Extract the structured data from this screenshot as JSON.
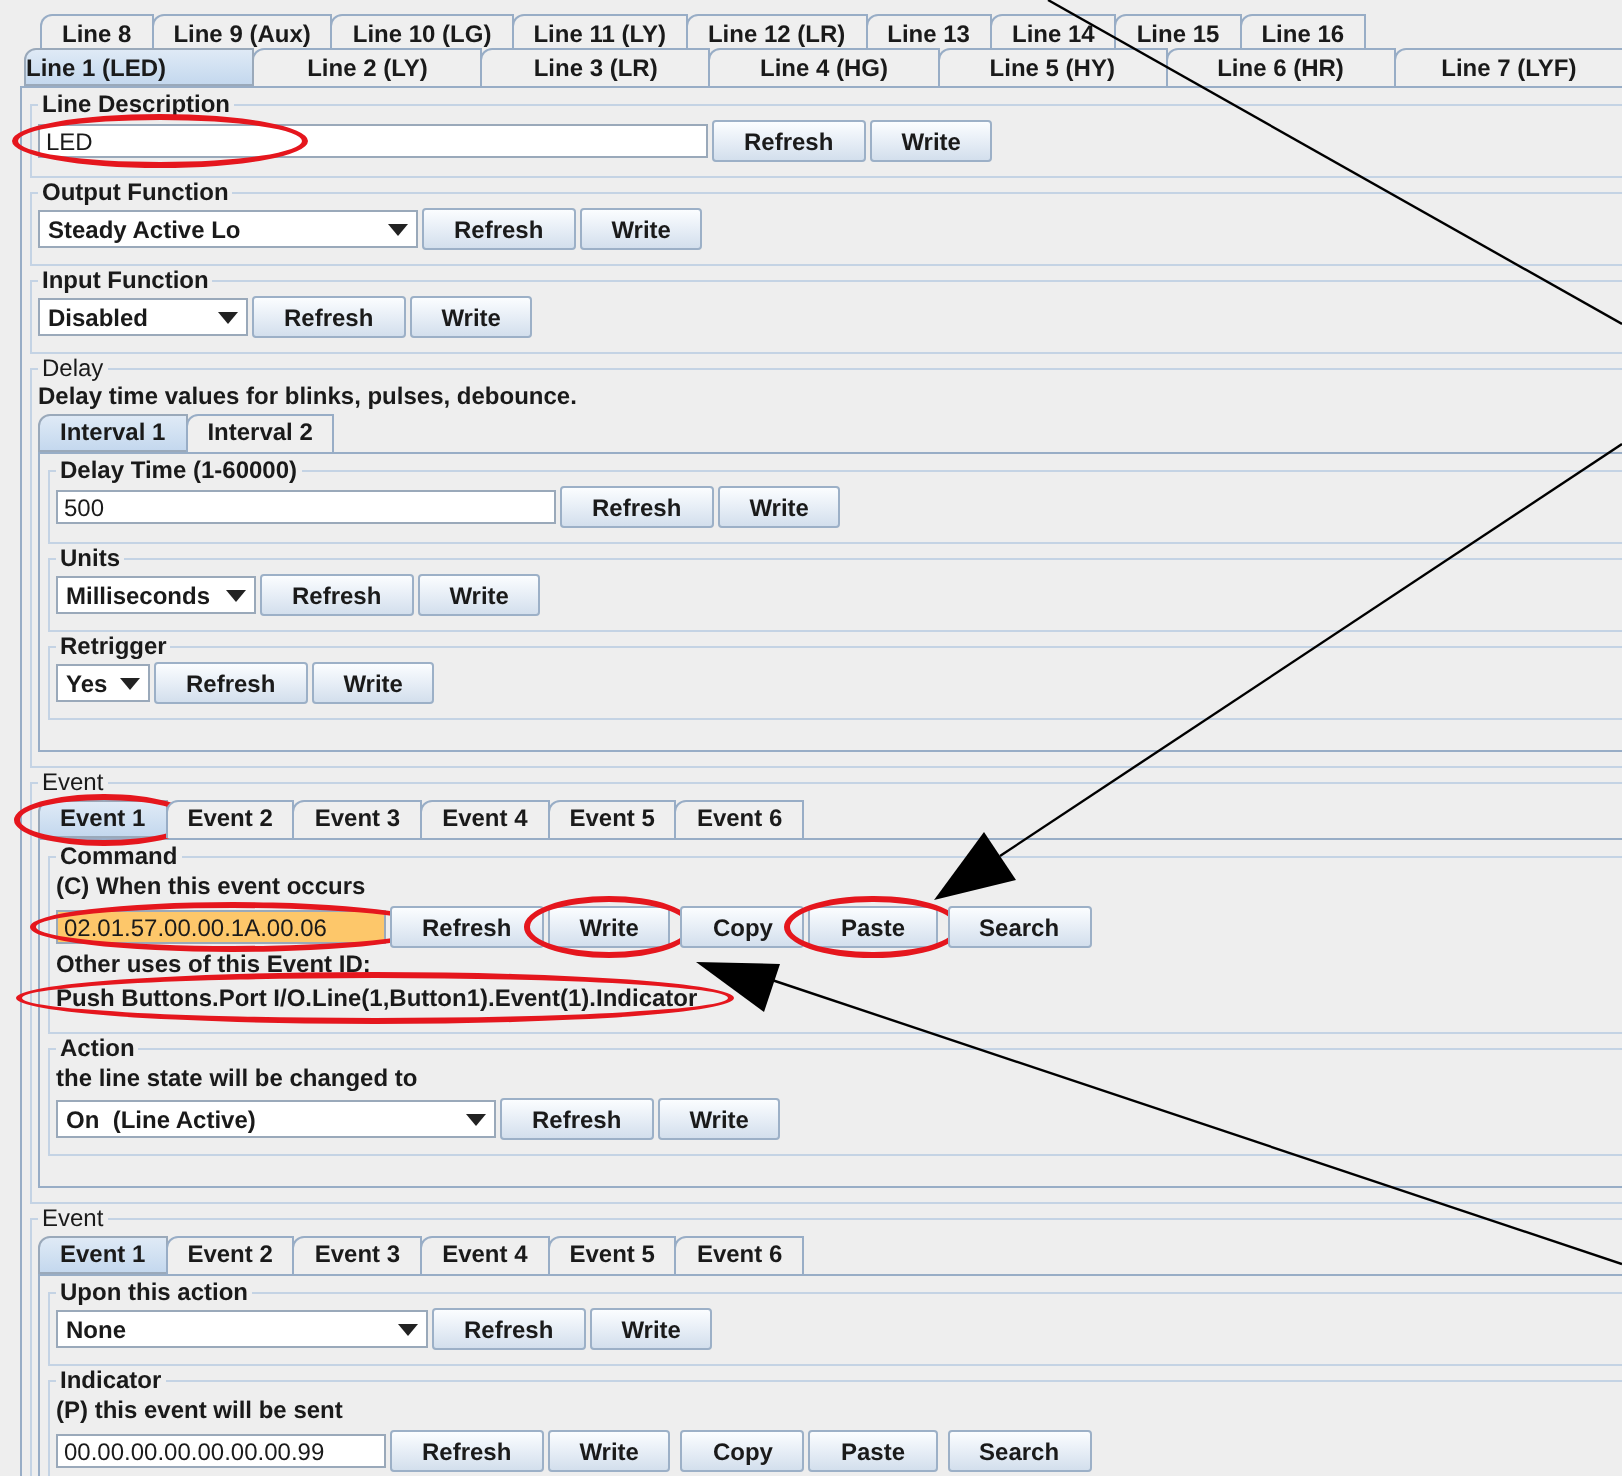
{
  "line_tabs_back_row": [
    {
      "label": "Line 8",
      "selected": false
    },
    {
      "label": "Line 9 (Aux)",
      "selected": false
    },
    {
      "label": "Line 10 (LG)",
      "selected": false
    },
    {
      "label": "Line 11 (LY)",
      "selected": false
    },
    {
      "label": "Line 12 (LR)",
      "selected": false
    },
    {
      "label": "Line 13",
      "selected": false
    },
    {
      "label": "Line 14",
      "selected": false
    },
    {
      "label": "Line 15",
      "selected": false
    },
    {
      "label": "Line 16",
      "selected": false
    }
  ],
  "line_tabs_front_row": [
    {
      "label": "Line 1 (LED)",
      "selected": true
    },
    {
      "label": "Line 2 (LY)",
      "selected": false
    },
    {
      "label": "Line 3 (LR)",
      "selected": false
    },
    {
      "label": "Line 4 (HG)",
      "selected": false
    },
    {
      "label": "Line 5 (HY)",
      "selected": false
    },
    {
      "label": "Line 6 (HR)",
      "selected": false
    },
    {
      "label": "Line 7 (LYF)",
      "selected": false
    }
  ],
  "settings": [
    {
      "title": "Line Description",
      "field": {
        "kind": "text",
        "value": "LED",
        "circled": true
      },
      "buttons": [
        [
          {
            "label": "Refresh",
            "circled": false
          },
          {
            "label": "Write",
            "circled": false
          }
        ]
      ]
    },
    {
      "title": "Output Function",
      "field": {
        "kind": "select",
        "value": "Steady Active Lo"
      },
      "buttons": [
        [
          {
            "label": "Refresh",
            "circled": false
          },
          {
            "label": "Write",
            "circled": false
          }
        ]
      ]
    },
    {
      "title": "Input Function",
      "field": {
        "kind": "select",
        "value": "Disabled"
      },
      "buttons": [
        [
          {
            "label": "Refresh",
            "circled": false
          },
          {
            "label": "Write",
            "circled": false
          }
        ]
      ]
    }
  ],
  "sections": [
    {
      "title": "Delay",
      "note": "Delay time values for blinks, pulses, debounce.",
      "tabs": [
        {
          "label": "Interval 1",
          "selected": true,
          "circled": false
        },
        {
          "label": "Interval 2",
          "selected": false,
          "circled": false
        }
      ],
      "groups": [
        {
          "title": "Delay Time (1-60000)",
          "field": {
            "kind": "text",
            "value": "500"
          },
          "buttons": [
            [
              {
                "label": "Refresh",
                "circled": false
              },
              {
                "label": "Write",
                "circled": false
              }
            ]
          ]
        },
        {
          "title": "Units",
          "field": {
            "kind": "select",
            "value": "Milliseconds"
          },
          "buttons": [
            [
              {
                "label": "Refresh",
                "circled": false
              },
              {
                "label": "Write",
                "circled": false
              }
            ]
          ]
        },
        {
          "title": "Retrigger",
          "field": {
            "kind": "select",
            "value": "Yes"
          },
          "buttons": [
            [
              {
                "label": "Refresh",
                "circled": false
              },
              {
                "label": "Write",
                "circled": false
              }
            ]
          ]
        }
      ]
    },
    {
      "title": "Event",
      "tabs": [
        {
          "label": "Event 1",
          "selected": true,
          "circled": true
        },
        {
          "label": "Event 2",
          "selected": false,
          "circled": false
        },
        {
          "label": "Event 3",
          "selected": false,
          "circled": false
        },
        {
          "label": "Event 4",
          "selected": false,
          "circled": false
        },
        {
          "label": "Event 5",
          "selected": false,
          "circled": false
        },
        {
          "label": "Event 6",
          "selected": false,
          "circled": false
        }
      ],
      "groups": [
        {
          "title": "Command",
          "caption": "(C) When this event occurs",
          "field": {
            "kind": "text",
            "value": "02.01.57.00.00.1A.00.06",
            "highlighted": true,
            "circled": true
          },
          "buttons": [
            [
              {
                "label": "Refresh",
                "circled": false
              },
              {
                "label": "Write",
                "circled": true
              }
            ],
            [
              {
                "label": "Copy",
                "circled": false
              },
              {
                "label": "Paste",
                "circled": true
              }
            ],
            [
              {
                "label": "Search",
                "circled": false
              }
            ]
          ],
          "uses_label": "Other uses of this Event ID:",
          "uses": "Push Buttons.Port I/O.Line(1,Button1).Event(1).Indicator",
          "uses_circled": true
        },
        {
          "title": "Action",
          "caption": "the line state will be changed to",
          "field": {
            "kind": "select",
            "value": "On  (Line Active)"
          },
          "buttons": [
            [
              {
                "label": "Refresh",
                "circled": false
              },
              {
                "label": "Write",
                "circled": false
              }
            ]
          ]
        }
      ]
    },
    {
      "title": "Event",
      "tabs": [
        {
          "label": "Event 1",
          "selected": true,
          "circled": false
        },
        {
          "label": "Event 2",
          "selected": false,
          "circled": false
        },
        {
          "label": "Event 3",
          "selected": false,
          "circled": false
        },
        {
          "label": "Event 4",
          "selected": false,
          "circled": false
        },
        {
          "label": "Event 5",
          "selected": false,
          "circled": false
        },
        {
          "label": "Event 6",
          "selected": false,
          "circled": false
        }
      ],
      "groups": [
        {
          "title": "Upon this action",
          "field": {
            "kind": "select",
            "value": "None"
          },
          "buttons": [
            [
              {
                "label": "Refresh",
                "circled": false
              },
              {
                "label": "Write",
                "circled": false
              }
            ]
          ]
        },
        {
          "title": "Indicator",
          "caption": "(P) this event will be sent",
          "field": {
            "kind": "text",
            "value": "00.00.00.00.00.00.00.99",
            "highlighted": false
          },
          "buttons": [
            [
              {
                "label": "Refresh",
                "circled": false
              },
              {
                "label": "Write",
                "circled": false
              }
            ],
            [
              {
                "label": "Copy",
                "circled": false
              },
              {
                "label": "Paste",
                "circled": false
              }
            ],
            [
              {
                "label": "Search",
                "circled": false
              }
            ]
          ]
        }
      ]
    }
  ]
}
